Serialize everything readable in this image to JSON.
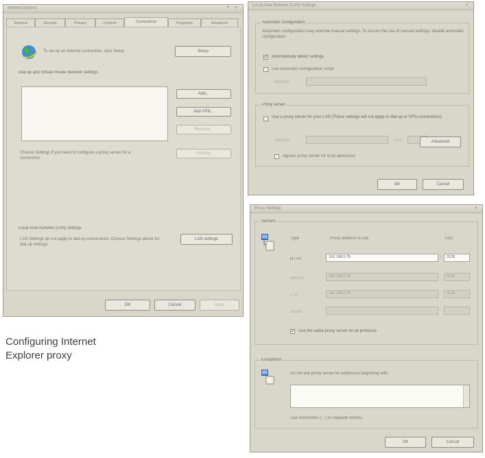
{
  "caption": {
    "line1": "Configuring Internet",
    "line2": "Explorer proxy"
  },
  "icons": {
    "globe": "globe-icon",
    "computer": "computer-network-icon",
    "close": "close-icon",
    "help": "help-icon"
  },
  "colors": {
    "dialog_bg": "#d9d6ca",
    "titlebar": "#cfccc0"
  },
  "internet_options": {
    "title": "Internet Options",
    "help_glyph": "?",
    "close_glyph": "×",
    "tabs": [
      "General",
      "Security",
      "Privacy",
      "Content",
      "Connections",
      "Programs",
      "Advanced"
    ],
    "setup_text": "To set up an Internet connection, click Setup.",
    "setup_button": "Setup",
    "dialup_heading": "Dial-up and Virtual Private Network settings",
    "add_button": "Add...",
    "add_vpn_button": "Add VPN...",
    "remove_button": "Remove...",
    "settings_button": "Settings",
    "proxy_note": "Choose Settings if you need to configure a proxy server for a connection.",
    "lan_heading": "Local Area Network (LAN) settings",
    "lan_note": "LAN Settings do not apply to dial-up connections. Choose Settings above for dial-up settings.",
    "lan_button": "LAN settings",
    "ok": "OK",
    "cancel": "Cancel",
    "apply": "Apply"
  },
  "lan_settings": {
    "title": "Local Area Network (LAN) Settings",
    "close_glyph": "×",
    "auto_heading": "Automatic configuration",
    "auto_text": "Automatic configuration may override manual settings. To ensure the use of manual settings, disable automatic configuration.",
    "auto_detect_label": "Automatically detect settings",
    "auto_detect_check": "✔",
    "script_label": "Use automatic configuration script",
    "address_label": "Address",
    "proxy_heading": "Proxy server",
    "proxy_label": "Use a proxy server for your LAN (These settings will not apply to dial-up or VPN connections).",
    "address2_label": "Address:",
    "port_label": "Port:",
    "advanced_button": "Advanced",
    "bypass_label": "Bypass proxy server for local addresses",
    "ok": "OK",
    "cancel": "Cancel"
  },
  "proxy_settings": {
    "title": "Proxy Settings",
    "close_glyph": "×",
    "servers_heading": "Servers",
    "type_header": "Type",
    "address_header": "Proxy address to use",
    "port_header": "Port",
    "rows": [
      {
        "type": "HTTP:",
        "address": "192.168.0.75",
        "port": "3128"
      },
      {
        "type": "Secure:",
        "address": "192.168.0.75",
        "port": "3128"
      },
      {
        "type": "FTP:",
        "address": "192.168.0.75",
        "port": "3128"
      },
      {
        "type": "Socks:",
        "address": "",
        "port": ""
      }
    ],
    "colon": ":",
    "same_proxy_label": "Use the same proxy server for all protocols",
    "same_proxy_check": "✔",
    "exceptions_heading": "Exceptions",
    "exceptions_text": "Do not use proxy server for addresses beginning with:",
    "exceptions_note": "Use semicolons ( ; ) to separate entries.",
    "ok": "OK",
    "cancel": "Cancel"
  }
}
